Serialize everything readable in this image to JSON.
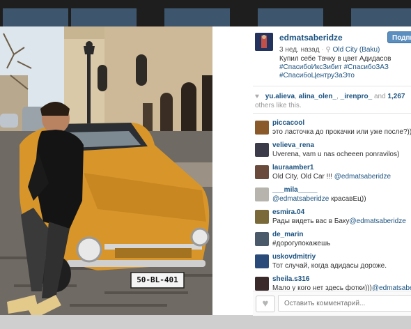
{
  "post": {
    "username": "edmatsaberidze",
    "follow_label": "Подпи",
    "time_ago": "3 нед. назад",
    "location": "Old City (Baku)",
    "caption_text": "Купил себе Тачку в цвет Адидасов",
    "hashtags": [
      "#СпасибоИксЗибит",
      "#СпасибоЗАЗ",
      "#СпасибоЦентруЗаЭто"
    ],
    "likes": {
      "users": [
        "yu.alieva",
        "alina_olen_",
        "_irenpro_"
      ],
      "and": "and",
      "count": "1,267",
      "suffix": "others like this."
    }
  },
  "photo": {
    "plate": "50-BL-401"
  },
  "comments": [
    {
      "user": "piccacool",
      "text": "это ласточка до прокачки или уже после?)))))))",
      "mention": ""
    },
    {
      "user": "velieva_rena",
      "text": "Uverena, vam u nas ocheeen ponravilos)",
      "mention": ""
    },
    {
      "user": "lauraamber1",
      "text": "Old City, Old Car !!! ",
      "mention": "@edmatsaberidze"
    },
    {
      "user": "___mila_____",
      "text": " красавЕц))",
      "mention": "@edmatsaberidze"
    },
    {
      "user": "esmira.04",
      "text": "Рады видеть вас в Баку",
      "mention": "@edmatsaberidze"
    },
    {
      "user": "de_marin",
      "text": "#дорогупокажешь",
      "mention": ""
    },
    {
      "user": "uskovdmitriy",
      "text": "Тот случай, когда адидасы дороже.",
      "mention": ""
    },
    {
      "user": "sheila.s316",
      "text": "Мало у кого нет здесь фотки)))",
      "mention": "@edmatsaberidze"
    }
  ],
  "input": {
    "placeholder": "Оставить комментарий..."
  },
  "icons": {
    "heart": "heart-icon",
    "location": "location-pin-icon"
  },
  "colors": {
    "link": "#1c5380",
    "follow": "#5b8fc0",
    "car": "#d8962a"
  }
}
